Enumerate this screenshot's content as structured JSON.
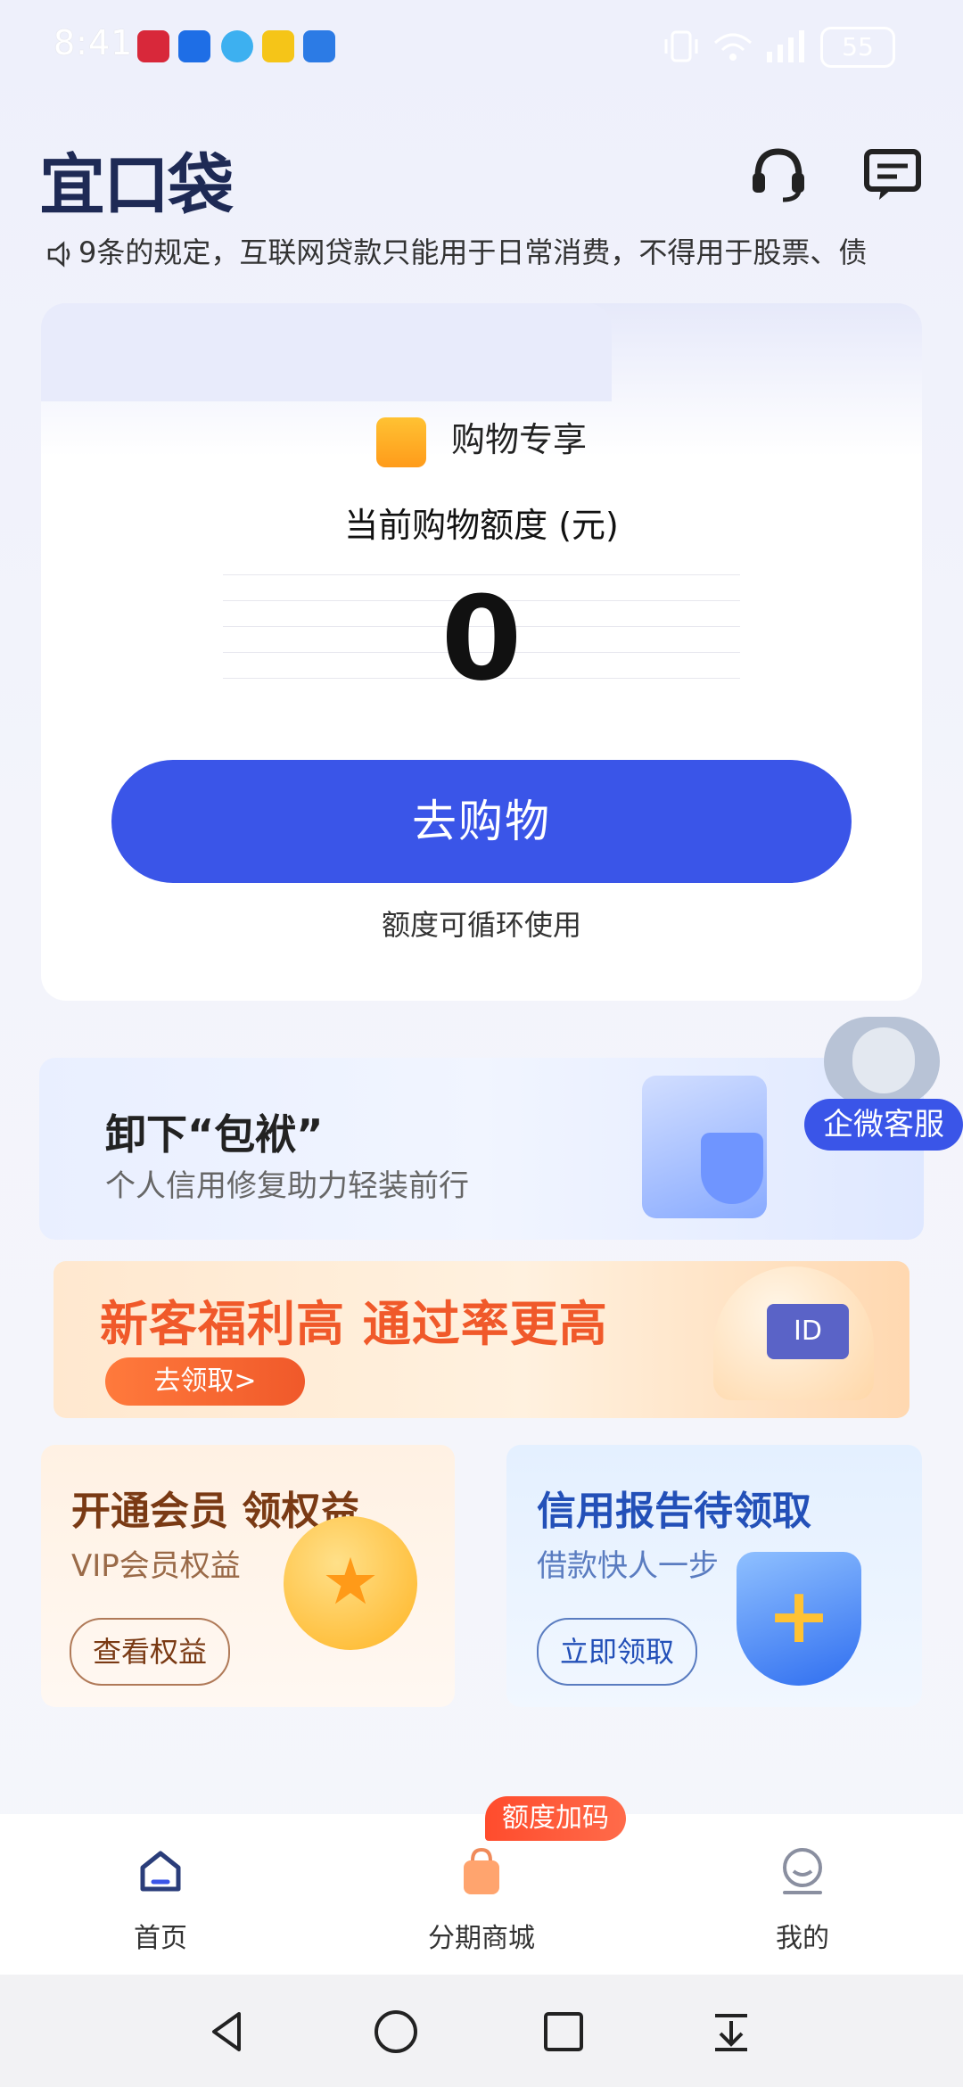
{
  "status_bar": {
    "time": "8:41",
    "battery": "55"
  },
  "header": {
    "logo": "宜口袋"
  },
  "marquee": {
    "text": "9条的规定，互联网贷款只能用于日常消费，不得用于股票、债"
  },
  "quota_card": {
    "section_title": "购物专享",
    "quota_label": "当前购物额度 (元)",
    "quota_value": "0",
    "shop_button": "去购物",
    "note": "额度可循环使用"
  },
  "banner_credit_repair": {
    "title": "卸下“包袱”",
    "subtitle": "个人信用修复助力轻装前行"
  },
  "customer_service": {
    "label": "企微客服"
  },
  "banner_new_customer": {
    "title": "新客福利高 通过率更高",
    "button": "去领取>",
    "card_text": "ID"
  },
  "vip_card": {
    "title": "开通会员 领权益",
    "subtitle": "VIP会员权益",
    "button": "查看权益"
  },
  "credit_card": {
    "title": "信用报告待领取",
    "subtitle": "借款快人一步",
    "button": "立即领取"
  },
  "tab_bar": {
    "badge": "额度加码",
    "items": [
      {
        "label": "首页"
      },
      {
        "label": "分期商城"
      },
      {
        "label": "我的"
      }
    ]
  },
  "colors": {
    "primary": "#3a55e8",
    "orange": "#f0592a",
    "badge": "#ff4c2d"
  }
}
